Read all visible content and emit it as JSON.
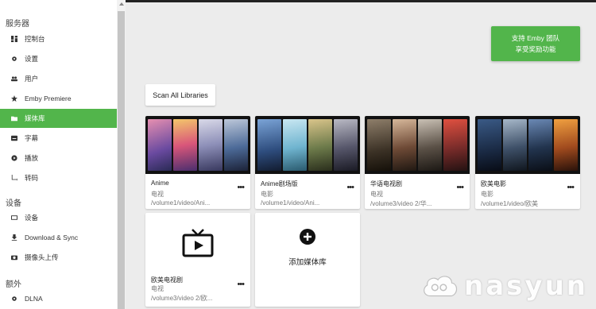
{
  "sidebar": {
    "sections": [
      {
        "label": "服务器"
      },
      {
        "label": "设备"
      },
      {
        "label": "额外"
      }
    ],
    "items": [
      {
        "label": "控制台",
        "icon": "dashboard-icon"
      },
      {
        "label": "设置",
        "icon": "gear-icon"
      },
      {
        "label": "用户",
        "icon": "people-icon"
      },
      {
        "label": "Emby Premiere",
        "icon": "star-icon"
      },
      {
        "label": "媒体库",
        "icon": "folder-icon",
        "active": true
      },
      {
        "label": "字幕",
        "icon": "subtitles-icon"
      },
      {
        "label": "播放",
        "icon": "play-circle-icon"
      },
      {
        "label": "转码",
        "icon": "transcode-icon"
      },
      {
        "label": "设备",
        "icon": "device-icon"
      },
      {
        "label": "Download & Sync",
        "icon": "download-icon"
      },
      {
        "label": "摄像头上传",
        "icon": "camera-icon"
      },
      {
        "label": "DLNA",
        "icon": "settings-icon"
      }
    ]
  },
  "support": {
    "line1": "支持 Emby 团队",
    "line2": "享受奖励功能"
  },
  "scan_label": "Scan All Libraries",
  "libraries": [
    {
      "title": "Anime",
      "type": "电视",
      "path": "/volume1/video/Ani..."
    },
    {
      "title": "Anime剧场版",
      "type": "电影",
      "path": "/volume1/video/Ani..."
    },
    {
      "title": "华语电视剧",
      "type": "电视",
      "path": "/volume3/video 2/华..."
    },
    {
      "title": "欧美电影",
      "type": "电影",
      "path": "/volume1/video/欧美"
    },
    {
      "title": "欧美电视剧",
      "type": "电视",
      "path": "/volume3/video 2/欧..."
    }
  ],
  "add_library_label": "添加媒体库",
  "more_label": "•••",
  "watermark": "nasyun",
  "colors": {
    "accent": "#52b54b",
    "background": "#ececec"
  }
}
